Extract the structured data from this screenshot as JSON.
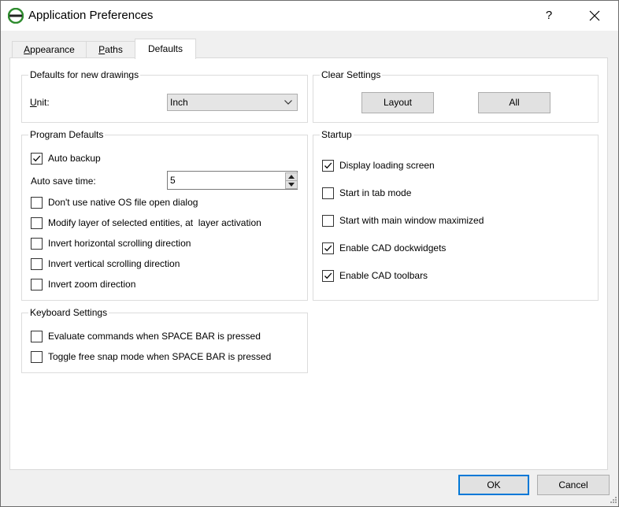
{
  "window": {
    "title": "Application Preferences",
    "help_label": "?"
  },
  "tabs": [
    {
      "label": "Appearance",
      "underline": "A",
      "rest": "ppearance",
      "active": false
    },
    {
      "label": "Paths",
      "underline": "P",
      "rest": "aths",
      "active": false
    },
    {
      "label": "Defaults",
      "active": true
    }
  ],
  "defaults_new_drawings": {
    "title": "Defaults for new drawings",
    "unit_label_u": "U",
    "unit_label_rest": "nit:",
    "unit_value": "Inch"
  },
  "clear_settings": {
    "title": "Clear Settings",
    "layout_label": "Layout",
    "all_label": "All"
  },
  "program_defaults": {
    "title": "Program Defaults",
    "auto_backup": {
      "label": "Auto backup",
      "checked": true
    },
    "auto_save_label": "Auto save time:",
    "auto_save_value": "5",
    "items": [
      {
        "label": "Don't use native OS file open dialog",
        "checked": false
      },
      {
        "label": "Modify layer of selected entities, at  layer activation",
        "checked": false
      },
      {
        "label": "Invert horizontal scrolling direction",
        "checked": false
      },
      {
        "label": "Invert vertical scrolling direction",
        "checked": false
      },
      {
        "label": "Invert zoom direction",
        "checked": false
      }
    ]
  },
  "startup": {
    "title": "Startup",
    "items": [
      {
        "label": "Display loading screen",
        "checked": true
      },
      {
        "label": "Start in tab mode",
        "checked": false
      },
      {
        "label": "Start with main window maximized",
        "checked": false
      },
      {
        "label": "Enable CAD dockwidgets",
        "checked": true
      },
      {
        "label": "Enable CAD toolbars",
        "checked": true
      }
    ]
  },
  "keyboard_settings": {
    "title": "Keyboard Settings",
    "items": [
      {
        "label": "Evaluate commands when SPACE BAR is pressed",
        "checked": false
      },
      {
        "label": "Toggle free snap mode when SPACE BAR is pressed",
        "checked": false
      }
    ]
  },
  "footer": {
    "ok_label": "OK",
    "cancel_label": "Cancel"
  },
  "colors": {
    "accent": "#0078d7",
    "icon_green": "#2e8b2e"
  }
}
